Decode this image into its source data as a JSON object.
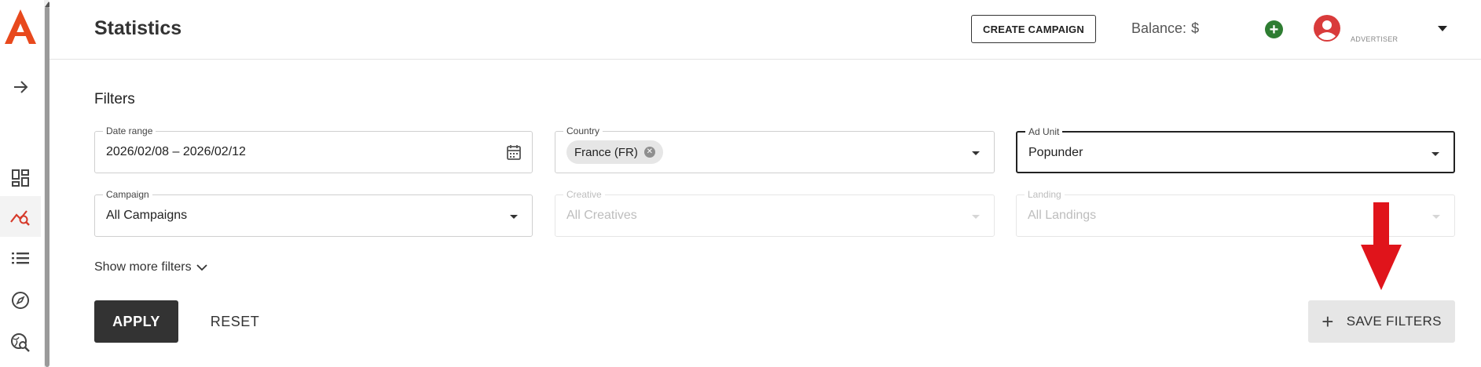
{
  "header": {
    "title": "Statistics",
    "create_campaign_label": "CREATE CAMPAIGN",
    "balance_label": "Balance:",
    "balance_currency": "$",
    "role": "ADVERTISER"
  },
  "sidebar": {
    "items": [
      {
        "icon": "arrow-right-icon"
      },
      {
        "icon": "dashboard-icon"
      },
      {
        "icon": "statistics-icon",
        "active": true
      },
      {
        "icon": "list-icon"
      },
      {
        "icon": "compass-icon"
      },
      {
        "icon": "search-globe-icon"
      }
    ]
  },
  "filters": {
    "title": "Filters",
    "date_range": {
      "label": "Date range",
      "value": "2026/02/08 – 2026/02/12"
    },
    "country": {
      "label": "Country",
      "chip": "France (FR)"
    },
    "ad_unit": {
      "label": "Ad Unit",
      "value": "Popunder"
    },
    "campaign": {
      "label": "Campaign",
      "value": "All Campaigns"
    },
    "creative": {
      "label": "Creative",
      "value": "All Creatives"
    },
    "landing": {
      "label": "Landing",
      "value": "All Landings"
    },
    "show_more": "Show more filters"
  },
  "actions": {
    "apply": "APPLY",
    "reset": "RESET",
    "save_filters": "SAVE FILTERS"
  },
  "colors": {
    "brand": "#e8491d",
    "add_button": "#2e7d32",
    "avatar": "#d93b3b",
    "primary_button": "#333333",
    "annotation_arrow": "#e0141b"
  }
}
